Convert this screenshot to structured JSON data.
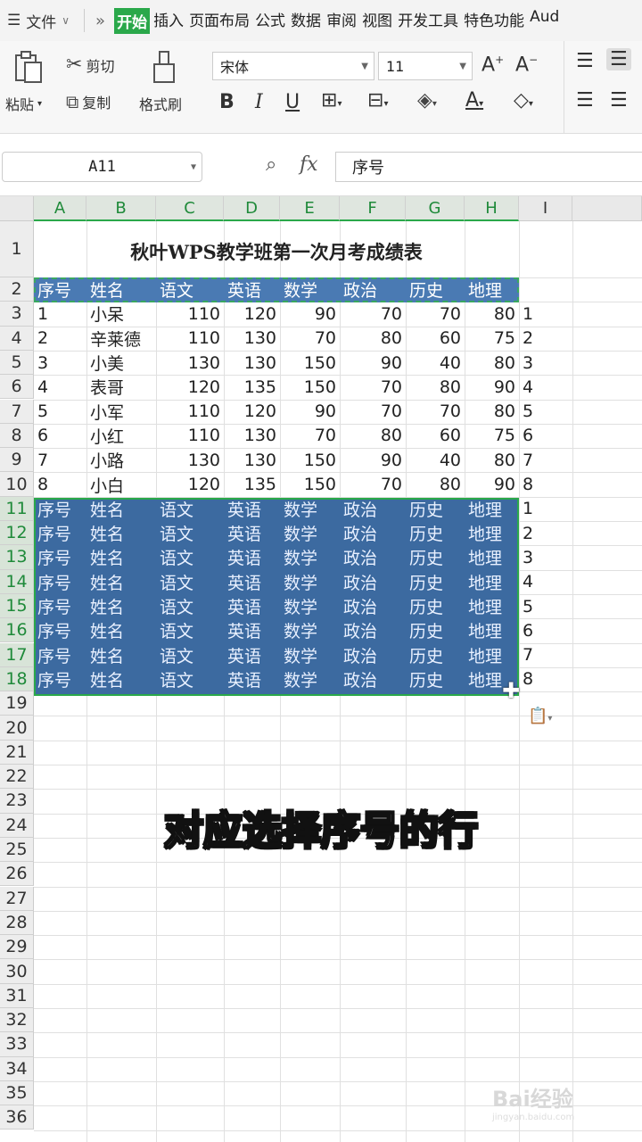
{
  "menubar": {
    "file_label": "文件",
    "tabs": [
      "开始",
      "插入",
      "页面布局",
      "公式",
      "数据",
      "审阅",
      "视图",
      "开发工具",
      "特色功能",
      "Aud"
    ],
    "active_tab": "开始"
  },
  "ribbon": {
    "paste": "粘贴",
    "cut": "剪切",
    "copy": "复制",
    "format_painter": "格式刷",
    "font_name": "宋体",
    "font_size": "11",
    "bold": "B",
    "italic": "I",
    "underline": "U",
    "grow": "A⁺",
    "shrink": "A⁻"
  },
  "formula_bar": {
    "cell_ref": "A11",
    "fx": "fx",
    "content": "序号"
  },
  "columns": [
    "A",
    "B",
    "C",
    "D",
    "E",
    "F",
    "G",
    "H",
    "I"
  ],
  "rows": [
    "1",
    "2",
    "3",
    "4",
    "5",
    "6",
    "7",
    "8",
    "9",
    "10",
    "11",
    "12",
    "13",
    "14",
    "15",
    "16",
    "17",
    "18",
    "19",
    "20",
    "21",
    "22",
    "23",
    "24",
    "25",
    "26",
    "27",
    "28",
    "29",
    "30",
    "31",
    "32",
    "33",
    "34",
    "35",
    "36"
  ],
  "sheet": {
    "title": "秋叶WPS教学班第一次月考成绩表",
    "headers": [
      "序号",
      "姓名",
      "语文",
      "英语",
      "数学",
      "政治",
      "历史",
      "地理"
    ],
    "data": [
      [
        "1",
        "小呆",
        "110",
        "120",
        "90",
        "70",
        "70",
        "80",
        "1"
      ],
      [
        "2",
        "辛莱德",
        "110",
        "130",
        "70",
        "80",
        "60",
        "75",
        "2"
      ],
      [
        "3",
        "小美",
        "130",
        "130",
        "150",
        "90",
        "40",
        "80",
        "3"
      ],
      [
        "4",
        "表哥",
        "120",
        "135",
        "150",
        "70",
        "80",
        "90",
        "4"
      ],
      [
        "5",
        "小军",
        "110",
        "120",
        "90",
        "70",
        "70",
        "80",
        "5"
      ],
      [
        "6",
        "小红",
        "110",
        "130",
        "70",
        "80",
        "60",
        "75",
        "6"
      ],
      [
        "7",
        "小路",
        "130",
        "130",
        "150",
        "90",
        "40",
        "80",
        "7"
      ],
      [
        "8",
        "小白",
        "120",
        "135",
        "150",
        "70",
        "80",
        "90",
        "8"
      ]
    ],
    "selected_rows": [
      [
        "序号",
        "姓名",
        "语文",
        "英语",
        "数学",
        "政治",
        "历史",
        "地理",
        "1"
      ],
      [
        "序号",
        "姓名",
        "语文",
        "英语",
        "数学",
        "政治",
        "历史",
        "地理",
        "2"
      ],
      [
        "序号",
        "姓名",
        "语文",
        "英语",
        "数学",
        "政治",
        "历史",
        "地理",
        "3"
      ],
      [
        "序号",
        "姓名",
        "语文",
        "英语",
        "数学",
        "政治",
        "历史",
        "地理",
        "4"
      ],
      [
        "序号",
        "姓名",
        "语文",
        "英语",
        "数学",
        "政治",
        "历史",
        "地理",
        "5"
      ],
      [
        "序号",
        "姓名",
        "语文",
        "英语",
        "数学",
        "政治",
        "历史",
        "地理",
        "6"
      ],
      [
        "序号",
        "姓名",
        "语文",
        "英语",
        "数学",
        "政治",
        "历史",
        "地理",
        "7"
      ],
      [
        "序号",
        "姓名",
        "语文",
        "英语",
        "数学",
        "政治",
        "历史",
        "地理",
        "8"
      ]
    ]
  },
  "caption": "对应选择序号的行",
  "watermark": "Bai经验",
  "watermark_sub": "jingyan.baidu.com",
  "colors": {
    "accent": "#2aa84a",
    "selection": "#3c6aa0"
  }
}
